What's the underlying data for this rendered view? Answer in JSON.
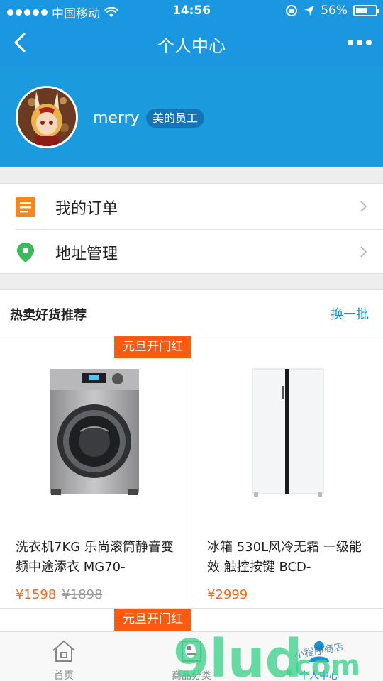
{
  "status_bar": {
    "carrier": "中国移动",
    "time": "14:56",
    "battery": "56%",
    "battery_level": 0.56
  },
  "nav": {
    "title": "个人中心"
  },
  "profile": {
    "username": "merry",
    "badge": "美的员工"
  },
  "menu": [
    {
      "label": "我的订单",
      "icon": "order-list-icon",
      "color": "#f5861f"
    },
    {
      "label": "地址管理",
      "icon": "location-pin-icon",
      "color": "#3bba5c"
    }
  ],
  "recommend": {
    "title": "热卖好货推荐",
    "refresh_label": "换一批"
  },
  "products": [
    {
      "tag": "元旦开门红",
      "name": "洗衣机7KG 乐尚滚筒静音变频中途添衣 MG70-",
      "price": "¥1598",
      "old_price": "¥1898",
      "image": "washing-machine-image"
    },
    {
      "tag": "",
      "name": "冰箱 530L风冷无霜 一级能效 触控按键 BCD-",
      "price": "¥2999",
      "old_price": "",
      "image": "refrigerator-image"
    }
  ],
  "next_row_tag": "元旦开门红",
  "tabs": [
    {
      "label": "首页",
      "icon": "home-icon",
      "active": false
    },
    {
      "label": "商品分类",
      "icon": "category-icon",
      "active": false
    },
    {
      "label": "个人中心",
      "icon": "user-icon",
      "active": true
    }
  ],
  "watermark": {
    "brand": "9lud.com",
    "caption": "小程序商店"
  },
  "colors": {
    "brand_blue": "#1a97e0",
    "promo_orange": "#fb5a0f",
    "price_orange": "#f26a1b"
  }
}
